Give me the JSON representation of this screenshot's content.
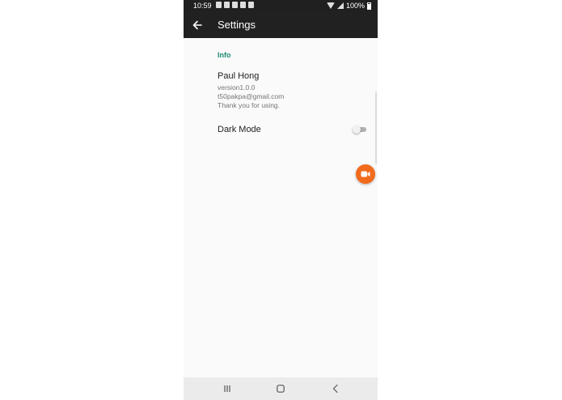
{
  "status_bar": {
    "time": "10:59",
    "battery": "100%"
  },
  "app_bar": {
    "title": "Settings",
    "back_icon": "arrow-left-icon"
  },
  "info_section": {
    "header": "Info",
    "name": "Paul Hong",
    "version": "version1.0.0",
    "email": "t50pakpa@gmail.com",
    "message": "Thank you for using."
  },
  "dark_mode": {
    "label": "Dark Mode",
    "enabled": false
  },
  "floating_button": {
    "icon": "video-camera-icon",
    "color": "#f26b1d"
  },
  "colors": {
    "app_bar": "#212121",
    "accent": "#1a8a70",
    "background": "#fafafa"
  },
  "nav_bar": {
    "recent_icon": "recent-apps-icon",
    "home_icon": "home-icon",
    "back_icon": "back-chevron-icon"
  }
}
